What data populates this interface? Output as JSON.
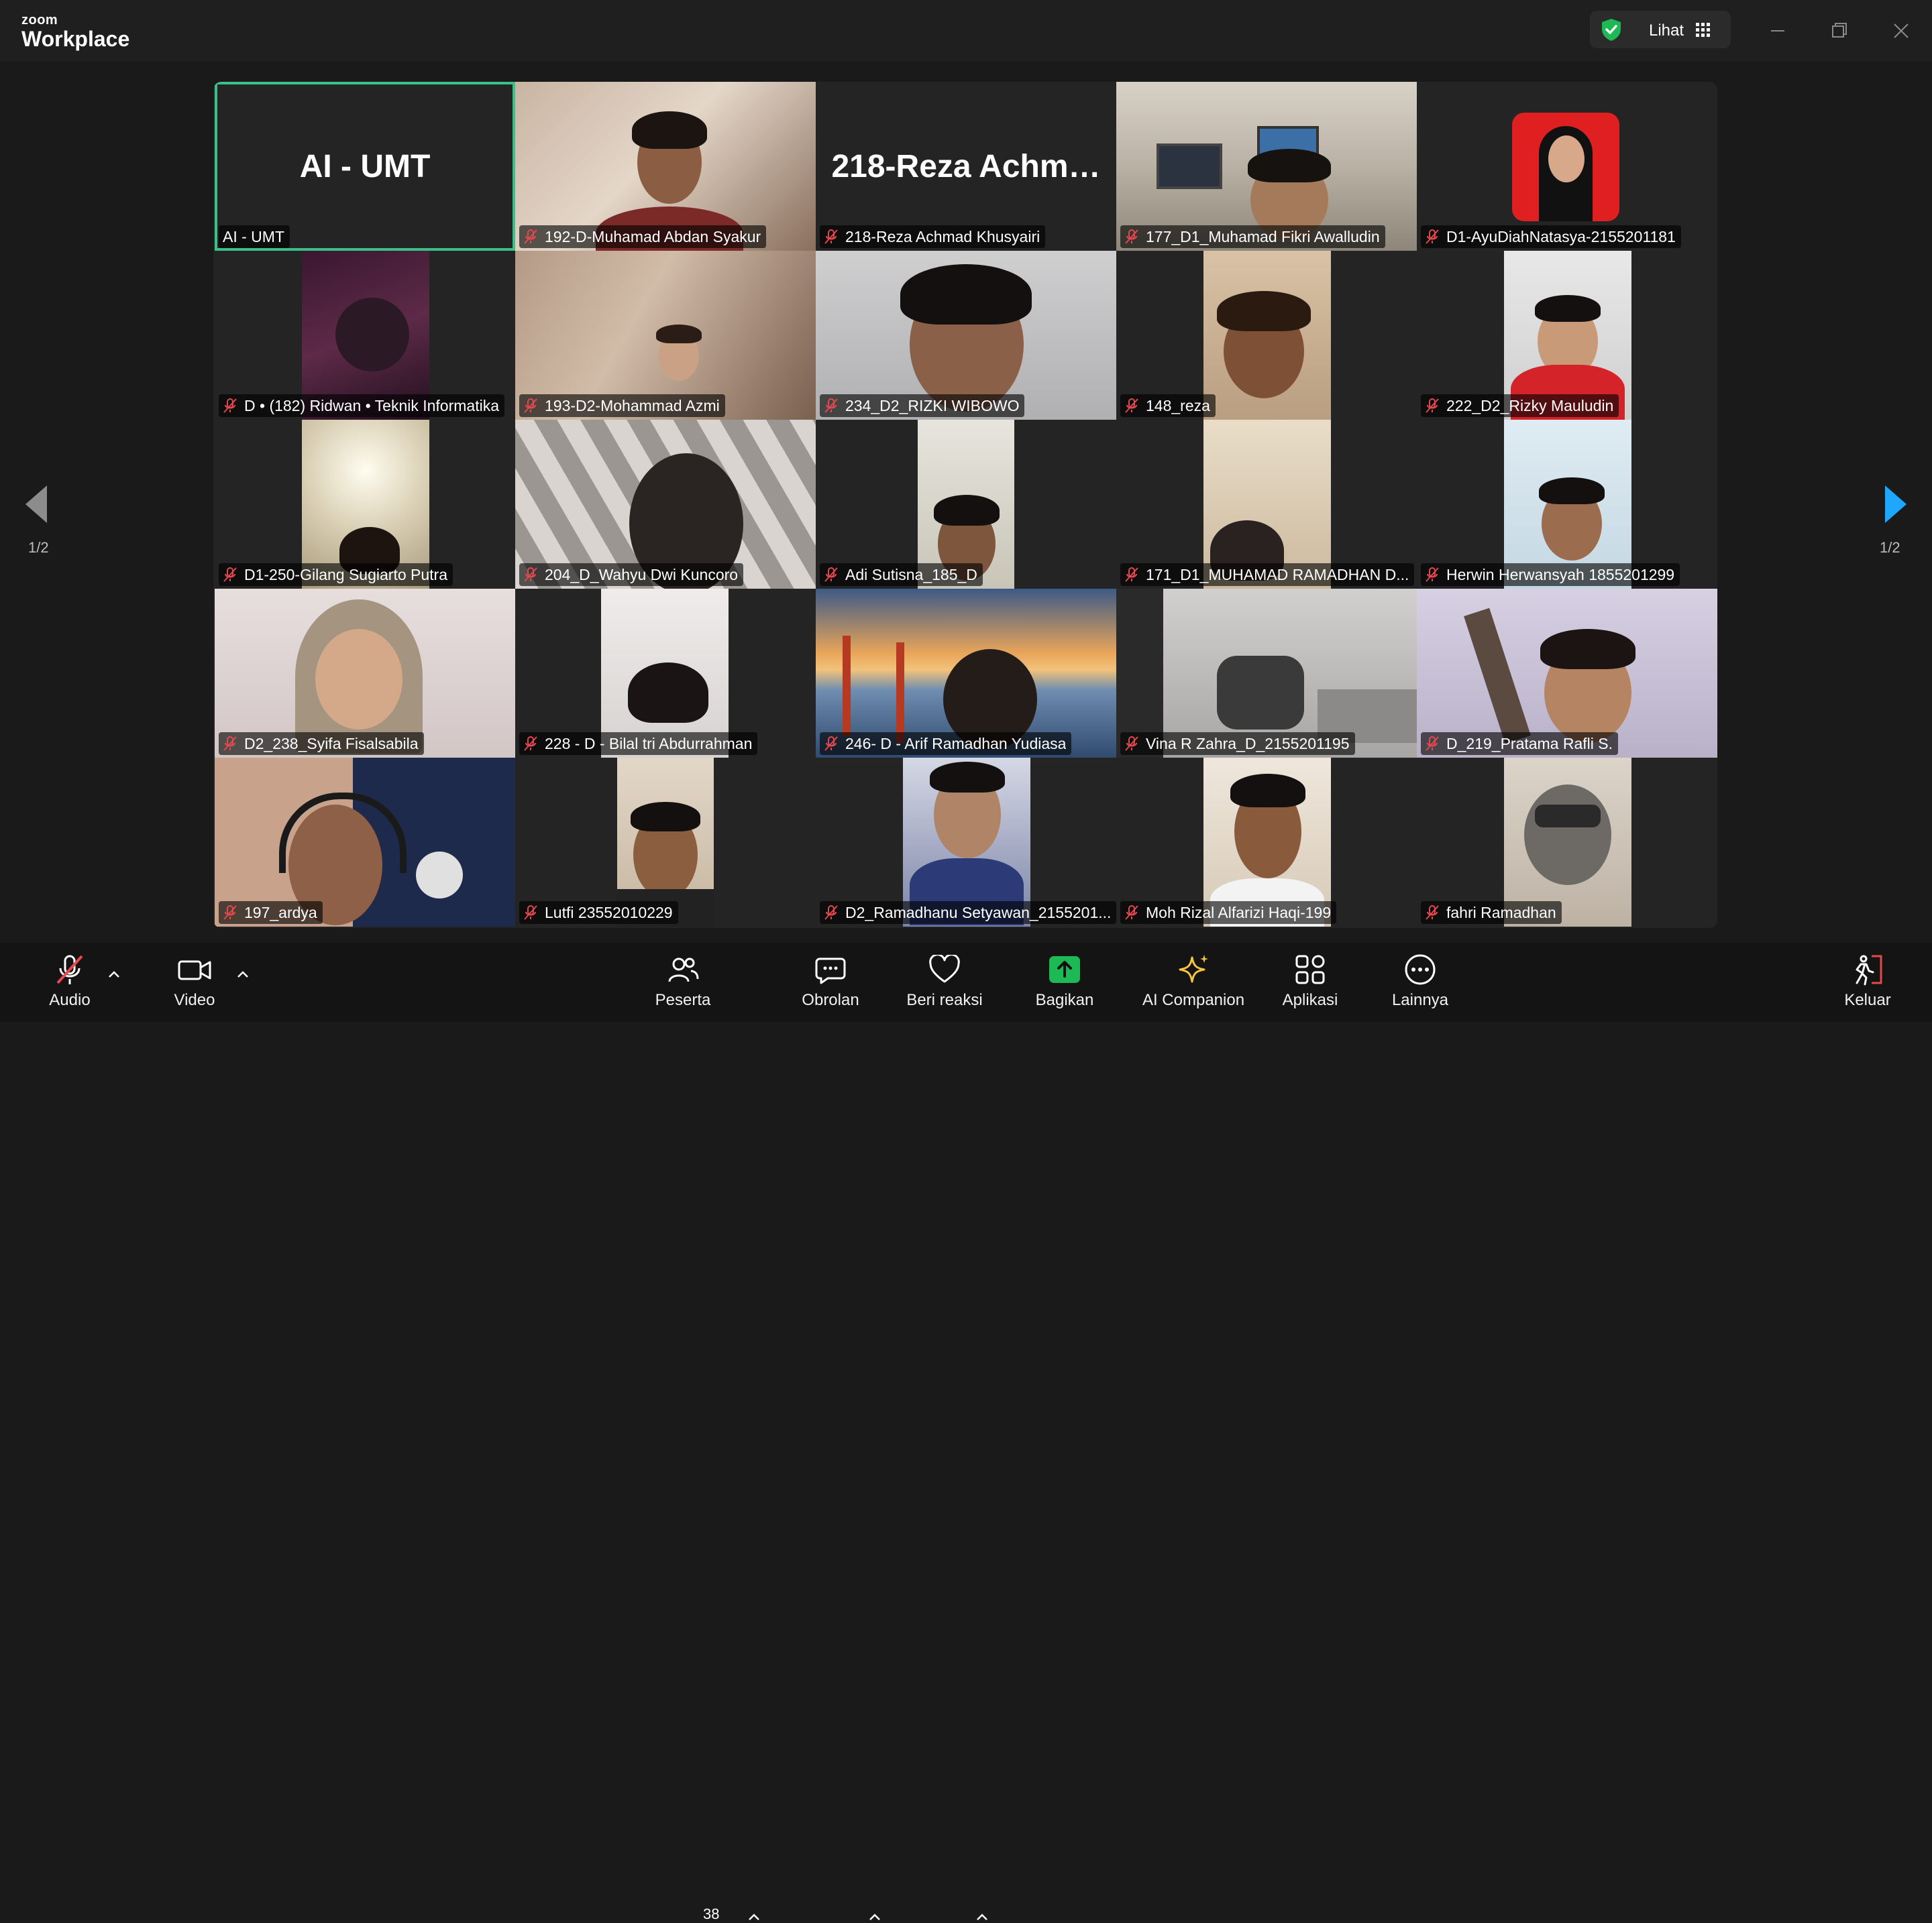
{
  "app": {
    "logo_small": "zoom",
    "logo_big": "Workplace"
  },
  "titlebar": {
    "view_label": "Lihat"
  },
  "colors": {
    "active_border": "#3cc08a",
    "share_green": "#1db954",
    "next_arrow": "#1ea7fd",
    "muted_red": "#e5484d"
  },
  "pagination": {
    "left": "1/2",
    "right": "1/2"
  },
  "tiles": [
    {
      "name": "AI - UMT",
      "avatar": "AI - UMT",
      "muted": false,
      "active": true
    },
    {
      "name": "192-D-Muhamad Abdan Syakur",
      "muted": true
    },
    {
      "name": "218-Reza Achmad Khusyairi",
      "avatar": "218-Reza  Achm…",
      "muted": true
    },
    {
      "name": "177_D1_Muhamad Fikri Awalludin",
      "muted": true
    },
    {
      "name": "D1-AyuDiahNatasya-2155201181",
      "muted": true
    },
    {
      "name": "D • (182) Ridwan • Teknik Informatika",
      "muted": true
    },
    {
      "name": "193-D2-Mohammad Azmi",
      "muted": true
    },
    {
      "name": "234_D2_RIZKI WIBOWO",
      "muted": true
    },
    {
      "name": "148_reza",
      "muted": true
    },
    {
      "name": "222_D2_Rizky Mauludin",
      "muted": true
    },
    {
      "name": "D1-250-Gilang Sugiarto Putra",
      "muted": true
    },
    {
      "name": "204_D_Wahyu Dwi Kuncoro",
      "muted": true
    },
    {
      "name": "Adi Sutisna_185_D",
      "muted": true
    },
    {
      "name": "171_D1_MUHAMAD RAMADHAN D...",
      "muted": true
    },
    {
      "name": "Herwin Herwansyah 1855201299",
      "muted": true
    },
    {
      "name": "D2_238_Syifa Fisalsabila",
      "muted": true
    },
    {
      "name": "228 - D - Bilal tri Abdurrahman",
      "muted": true
    },
    {
      "name": "246- D - Arif Ramadhan Yudiasa",
      "muted": true
    },
    {
      "name": "Vina R Zahra_D_2155201195",
      "muted": true
    },
    {
      "name": "D_219_Pratama Rafli S.",
      "muted": true
    },
    {
      "name": "197_ardya",
      "muted": true
    },
    {
      "name": "Lutfi 23552010229",
      "muted": true
    },
    {
      "name": "D2_Ramadhanu Setyawan_2155201...",
      "muted": true
    },
    {
      "name": "Moh Rizal Alfarizi Haqi-199",
      "muted": true
    },
    {
      "name": "fahri Ramadhan",
      "muted": true
    }
  ],
  "toolbar": {
    "audio": "Audio",
    "video": "Video",
    "participants": "Peserta",
    "participants_count": "38",
    "chat": "Obrolan",
    "react": "Beri reaksi",
    "share": "Bagikan",
    "ai": "AI Companion",
    "apps": "Aplikasi",
    "more": "Lainnya",
    "leave": "Keluar"
  }
}
